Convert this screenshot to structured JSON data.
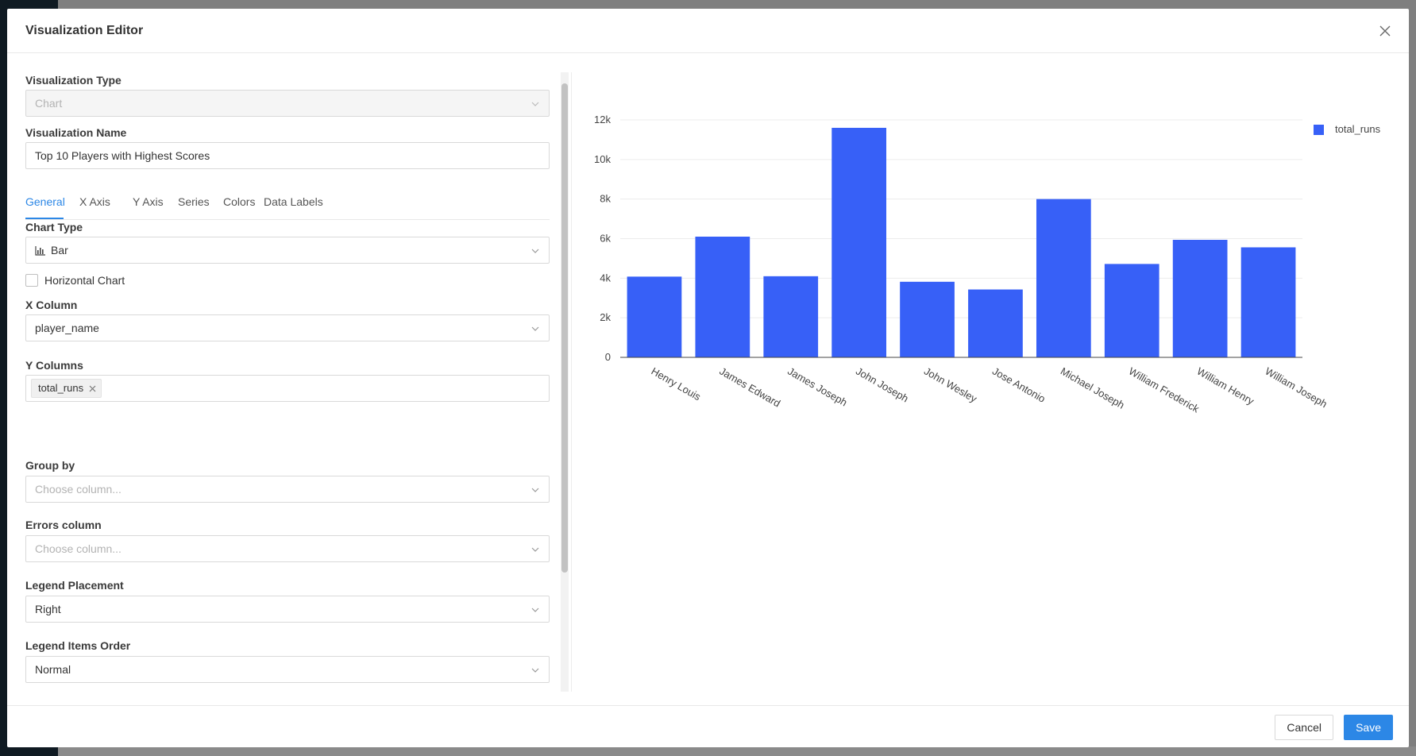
{
  "modal": {
    "title": "Visualization Editor"
  },
  "form": {
    "viz_type_label": "Visualization Type",
    "viz_type_value": "Chart",
    "viz_name_label": "Visualization Name",
    "viz_name_value": "Top 10 Players with Highest Scores",
    "tabs": [
      {
        "label": "General",
        "active": true
      },
      {
        "label": "X Axis"
      },
      {
        "label": "Y Axis"
      },
      {
        "label": "Series"
      },
      {
        "label": "Colors"
      },
      {
        "label": "Data Labels"
      }
    ],
    "chart_type_label": "Chart Type",
    "chart_type_value": "Bar",
    "horizontal_label": "Horizontal Chart",
    "x_column_label": "X Column",
    "x_column_value": "player_name",
    "y_columns_label": "Y Columns",
    "y_column_tag": "total_runs",
    "group_by_label": "Group by",
    "group_by_placeholder": "Choose column...",
    "errors_label": "Errors column",
    "errors_placeholder": "Choose column...",
    "legend_placement_label": "Legend Placement",
    "legend_placement_value": "Right",
    "legend_order_label": "Legend Items Order",
    "legend_order_value": "Normal"
  },
  "footer": {
    "cancel_label": "Cancel",
    "save_label": "Save"
  },
  "colors": {
    "bar": "#3760f7",
    "accent": "#2c87e6"
  },
  "chart_data": {
    "type": "bar",
    "categories": [
      "Henry Louis",
      "James Edward",
      "James Joseph",
      "John Joseph",
      "John Wesley",
      "Jose Antonio",
      "Michael Joseph",
      "William Frederick",
      "William Henry",
      "William Joseph"
    ],
    "series": [
      {
        "name": "total_runs",
        "values": [
          4080,
          6100,
          4100,
          11600,
          3820,
          3430,
          8000,
          4720,
          5940,
          5560
        ]
      }
    ],
    "ylim": [
      0,
      12000
    ],
    "yticks": [
      0,
      2000,
      4000,
      6000,
      8000,
      10000,
      12000
    ],
    "ytick_labels": [
      "0",
      "2k",
      "4k",
      "6k",
      "8k",
      "10k",
      "12k"
    ],
    "grid": true,
    "legend": "right"
  }
}
